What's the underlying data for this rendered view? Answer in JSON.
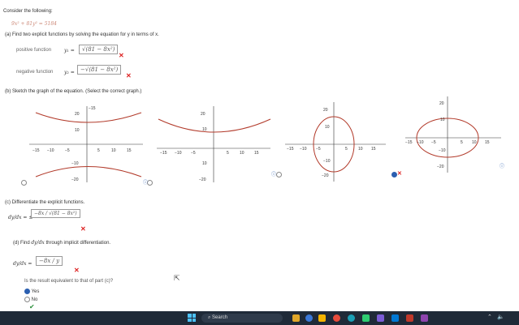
{
  "problem": {
    "header": "Consider the following:",
    "equation": "9x² + 81y² = 5184"
  },
  "partA": {
    "prompt": "(a)  Find two explicit functions by solving the equation for y in terms of x.",
    "pos_label": "positive function",
    "pos_var": "y₁ =",
    "pos_answer": "√(81 − 8x²)",
    "neg_label": "negative function",
    "neg_var": "y₂ =",
    "neg_answer": "−√(81 − 8x²)"
  },
  "partB": {
    "prompt": "(b)  Sketch the graph of the equation. (Select the correct graph.)"
  },
  "graphs": [
    {
      "ticks_x": [
        "−15",
        "−10",
        "−5",
        "5",
        "10",
        "15"
      ],
      "ticks_y": [
        "20",
        "10",
        "−10",
        "−20"
      ]
    },
    {
      "ticks_x": [
        "−15",
        "−10",
        "−5",
        "5",
        "10",
        "15"
      ],
      "ticks_y": [
        "20",
        "10",
        "10",
        "−20"
      ]
    },
    {
      "ticks_x": [
        "−15",
        "−10",
        "−5",
        "5",
        "10",
        "15"
      ],
      "ticks_y": [
        "20",
        "10",
        "−10",
        "−20"
      ]
    },
    {
      "ticks_x": [
        "−15",
        "−10",
        "−5",
        "5",
        "10",
        "15"
      ],
      "ticks_y": [
        "20",
        "10",
        "−10",
        "−20"
      ]
    }
  ],
  "partC": {
    "prompt": "(c)  Differentiate the explicit functions.",
    "lhs": "dy/dx = ±",
    "answer": "−8x / √(81 − 8x²)"
  },
  "partD": {
    "prompt_a": "(d)  Find",
    "prompt_b": "dy/dx",
    "prompt_c": "through implicit differentiation.",
    "lhs": "dy/dx =",
    "answer": "−8x / y",
    "question": "Is the result equivalent to that of part (c)?",
    "opt_yes": "Yes",
    "opt_no": "No"
  },
  "taskbar": {
    "search_label": "Search"
  },
  "colors": {
    "curve": "#b23a2a",
    "answer_text": "#2b5fb0",
    "wrong": "#dd2222",
    "taskbar": "#1f2a38"
  }
}
